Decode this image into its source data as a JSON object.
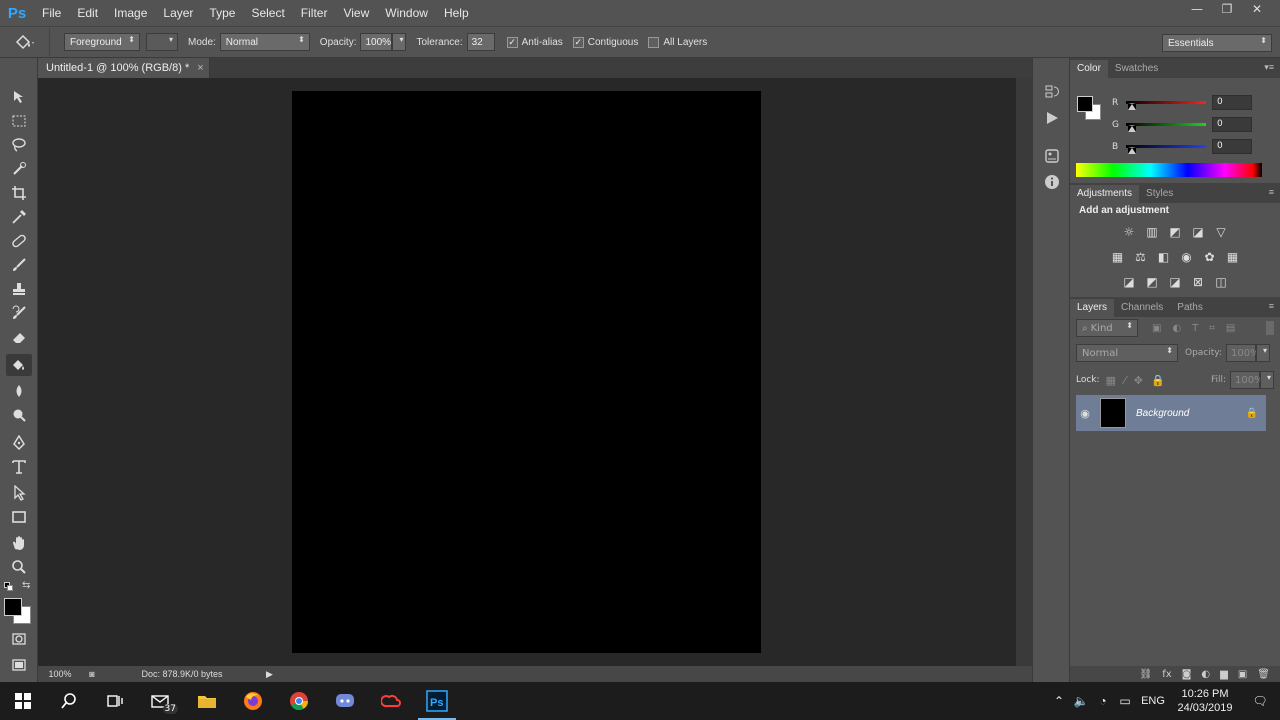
{
  "app": {
    "logo": "Ps",
    "menu": [
      "File",
      "Edit",
      "Image",
      "Layer",
      "Type",
      "Select",
      "Filter",
      "View",
      "Window",
      "Help"
    ],
    "window_controls": [
      "—",
      "❐",
      "✕"
    ]
  },
  "options": {
    "fill_source": "Foreground",
    "mode_label": "Mode:",
    "mode_value": "Normal",
    "opacity_label": "Opacity:",
    "opacity_value": "100%",
    "tolerance_label": "Tolerance:",
    "tolerance_value": "32",
    "anti_alias_label": "Anti-alias",
    "anti_alias_checked": true,
    "contiguous_label": "Contiguous",
    "contiguous_checked": true,
    "all_layers_label": "All Layers",
    "all_layers_checked": false,
    "workspace": "Essentials"
  },
  "document": {
    "tab_title": "Untitled-1 @ 100% (RGB/8) *",
    "zoom": "100%",
    "doc_info": "Doc: 878.9K/0 bytes",
    "canvas_color": "#000000"
  },
  "color_panel": {
    "tabs": [
      "Color",
      "Swatches"
    ],
    "foreground": "#000000",
    "background": "#ffffff",
    "channels": [
      {
        "label": "R",
        "value": "0",
        "color": "#ff2020"
      },
      {
        "label": "G",
        "value": "0",
        "color": "#20d020"
      },
      {
        "label": "B",
        "value": "0",
        "color": "#2040ff"
      }
    ]
  },
  "adjustments_panel": {
    "tabs": [
      "Adjustments",
      "Styles"
    ],
    "title": "Add an adjustment"
  },
  "layers_panel": {
    "tabs": [
      "Layers",
      "Channels",
      "Paths"
    ],
    "filter_kind": "Kind",
    "blend_mode": "Normal",
    "opacity_label": "Opacity:",
    "opacity_value": "100%",
    "lock_label": "Lock:",
    "fill_label": "Fill:",
    "fill_value": "100%",
    "layers": [
      {
        "name": "Background",
        "visible": true,
        "locked": true
      }
    ]
  },
  "taskbar": {
    "mail_badge": "37",
    "language": "ENG",
    "time": "10:26 PM",
    "date": "24/03/2019"
  }
}
